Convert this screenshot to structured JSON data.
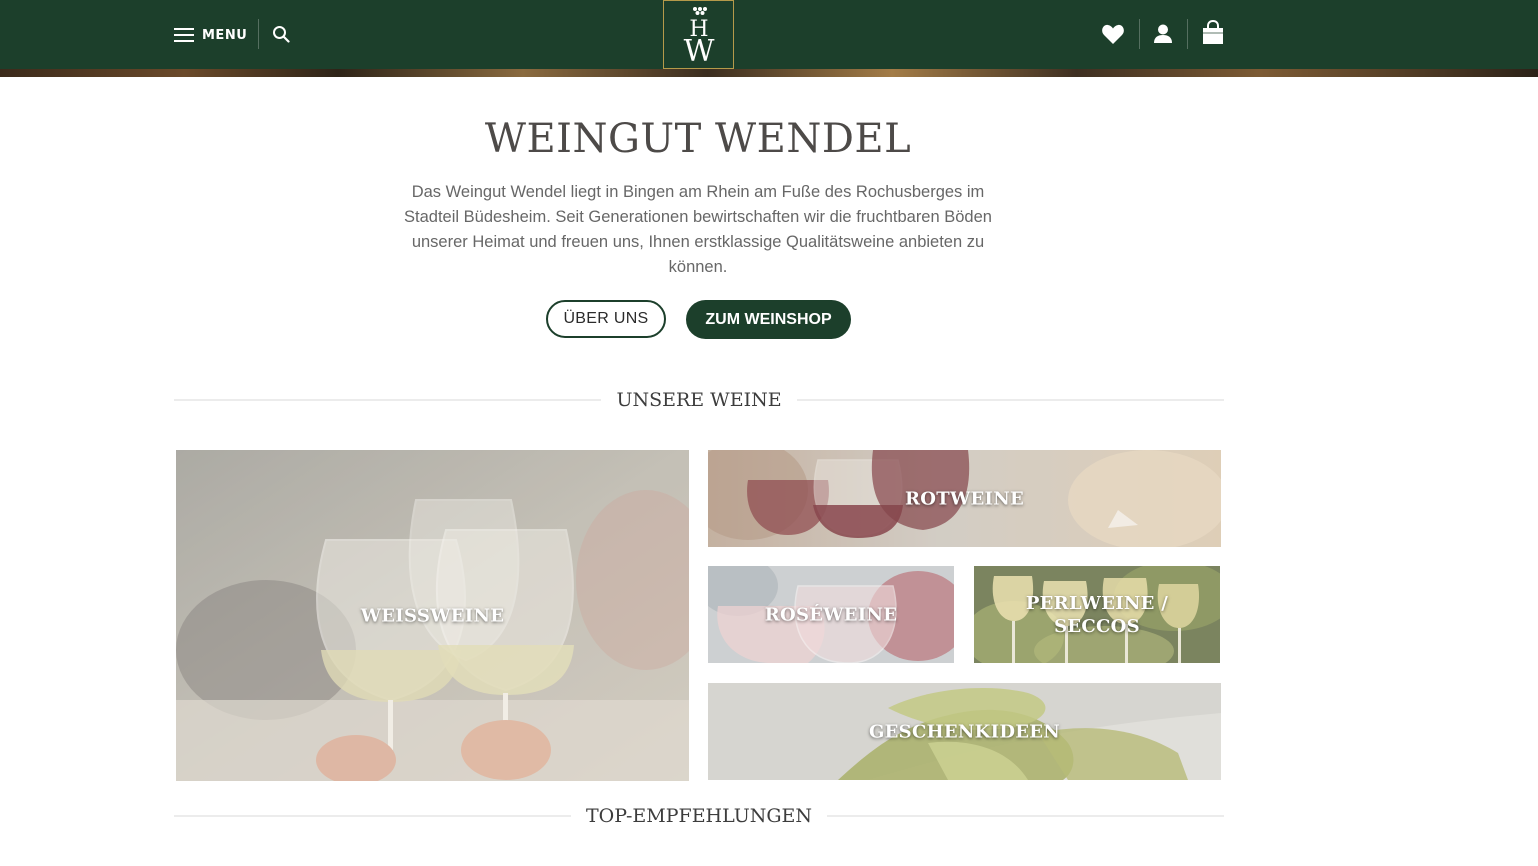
{
  "header": {
    "menu_label": "MENU",
    "logo_text": "HW",
    "colors": {
      "bar": "#1c3f2b",
      "logo_border": "#b59a4a"
    },
    "icons": [
      "hamburger-icon",
      "search-icon",
      "heart-icon",
      "user-icon",
      "shopping-bag-icon"
    ]
  },
  "intro": {
    "title": "WEINGUT WENDEL",
    "text": "Das Weingut Wendel liegt in Bingen am Rhein am Fuße des Rochusberges im Stadteil Büdesheim. Seit Generationen bewirtschaften wir die fruchtbaren Böden unserer Heimat und freuen uns, Ihnen erstklassige Qualitätsweine anbieten zu können.",
    "button_about": "ÜBER UNS",
    "button_shop": "ZUM WEINSHOP"
  },
  "sections": {
    "wines": "UNSERE WEINE",
    "top": "TOP-EMPFEHLUNGEN"
  },
  "tiles": {
    "white": "WEISSWEINE",
    "red": "ROTWEINE",
    "rose": "ROSÉWEINE",
    "sparkling": "PERLWEINE / SECCOS",
    "gifts": "GESCHENKIDEEN"
  }
}
